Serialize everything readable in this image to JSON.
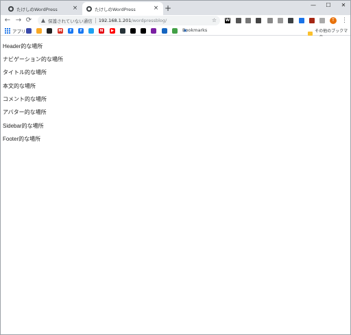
{
  "tabs": [
    {
      "title": "たけしのWordPress",
      "active": false
    },
    {
      "title": "たけしのWordPress",
      "active": true
    }
  ],
  "tab_close_glyph": "×",
  "new_tab_glyph": "+",
  "window_controls": {
    "minimize": "—",
    "maximize": "☐",
    "close": "✕"
  },
  "nav": {
    "back": "←",
    "forward": "→",
    "reload": "⟳"
  },
  "omnibox": {
    "security_label": "保護されていない通信",
    "url_host": "192.168.1.201",
    "url_path": "/wordpressblog/"
  },
  "extensions": [
    {
      "icon": "w-icon",
      "label": "W",
      "color": "#000000"
    },
    {
      "icon": "square-ext-icon",
      "label": "",
      "color": "#555555"
    },
    {
      "icon": "ext-box-icon",
      "label": "",
      "color": "#777777"
    },
    {
      "icon": "circle-ext-icon",
      "label": "",
      "color": "#444444"
    },
    {
      "icon": "leaf-icon",
      "label": "",
      "color": "#888888"
    },
    {
      "icon": "mail-ext-icon",
      "label": "",
      "color": "#999999"
    },
    {
      "icon": "translate-icon",
      "label": "",
      "color": "#3c4043"
    },
    {
      "icon": "badge-ext-icon",
      "label": "",
      "color": "#1a73e8"
    },
    {
      "icon": "shield-ext-icon",
      "label": "",
      "color": "#a52714"
    },
    {
      "icon": "ext-gray-icon",
      "label": "",
      "color": "#aaaaaa"
    },
    {
      "icon": "puzzle-icon",
      "label": "",
      "color": "#5f6368"
    }
  ],
  "profile_initial": "T",
  "menu_glyph": "⋮",
  "bookmarks": {
    "apps_label": "アプリ",
    "items": [
      {
        "icon": "bookmark-icon-1",
        "label": "",
        "color": "#3949ab"
      },
      {
        "icon": "bookmark-icon-2",
        "label": "",
        "color": "#f9a825"
      },
      {
        "icon": "bookmark-icon-3",
        "label": "",
        "color": "#212121"
      },
      {
        "icon": "gmail-icon",
        "label": "M",
        "color": "#d93025"
      },
      {
        "icon": "facebook-icon",
        "label": "f",
        "color": "#1877f2"
      },
      {
        "icon": "facebook-icon-2",
        "label": "f",
        "color": "#1877f2"
      },
      {
        "icon": "twitter-icon",
        "label": "",
        "color": "#1da1f2"
      },
      {
        "icon": "netflix-icon",
        "label": "N",
        "color": "#e50914"
      },
      {
        "icon": "youtube-icon",
        "label": "▶",
        "color": "#ff0000"
      },
      {
        "icon": "bookmark-icon-10",
        "label": "",
        "color": "#263238"
      },
      {
        "icon": "bookmark-icon-11",
        "label": "",
        "color": "#000000"
      },
      {
        "icon": "bookmark-icon-12",
        "label": "",
        "color": "#000000"
      },
      {
        "icon": "bookmark-icon-13",
        "label": "",
        "color": "#7b1fa2"
      },
      {
        "icon": "bookmark-icon-14",
        "label": "",
        "color": "#1565c0"
      },
      {
        "icon": "bookmark-icon-15",
        "label": "",
        "color": "#43a047"
      },
      {
        "icon": "star-bookmark-icon",
        "label": "★",
        "color": "#1a73e8"
      }
    ],
    "folder_label": "Bookmarks",
    "other_label": "その他のブックマーク"
  },
  "content": {
    "labels": [
      "Header的な場所",
      "ナビゲーション的な場所",
      "タイトル的な場所",
      "本文的な場所",
      "コメント的な場所",
      "アバター的な場所",
      "Sidebar的な場所",
      "Footer的な場所"
    ]
  }
}
